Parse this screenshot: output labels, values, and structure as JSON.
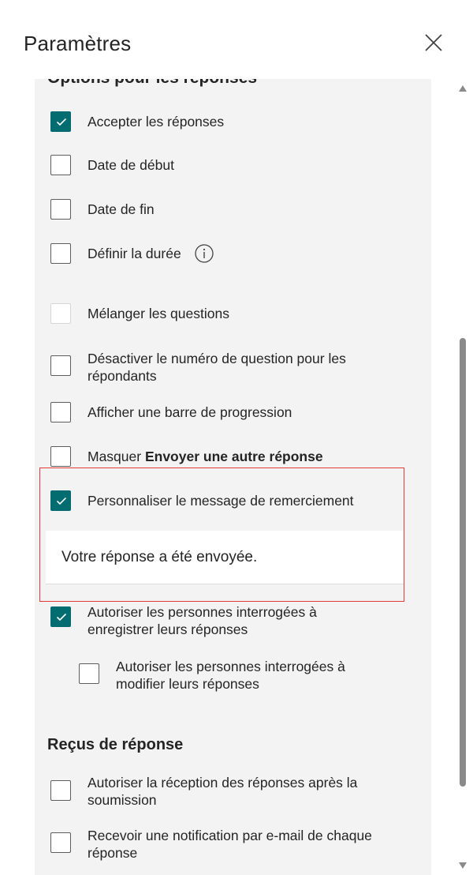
{
  "panel": {
    "title": "Paramètres"
  },
  "response_options": {
    "section_title": "Options pour les réponses",
    "items": [
      {
        "label": "Accepter les réponses",
        "checked": true
      },
      {
        "label": "Date de début",
        "checked": false
      },
      {
        "label": "Date de fin",
        "checked": false
      },
      {
        "label": "Définir la durée",
        "checked": false,
        "icon": "info-icon"
      },
      {
        "label": "Mélanger les questions",
        "checked": false,
        "disabled": true
      },
      {
        "label": "Désactiver le numéro de question pour les répondants",
        "checked": false
      },
      {
        "label": "Afficher une barre de progression",
        "checked": false
      },
      {
        "label_prefix": "Masquer ",
        "label_bold": "Envoyer une autre réponse",
        "checked": false
      },
      {
        "label": "Personnaliser le message de remerciement",
        "checked": true
      },
      {
        "label": "Autoriser les personnes interrogées à enregistrer leurs réponses",
        "checked": true
      },
      {
        "label": "Autoriser les personnes interrogées à modifier leurs réponses",
        "checked": false
      }
    ],
    "thank_you_message": "Votre réponse a été envoyée."
  },
  "receipts": {
    "section_title": "Reçus de réponse",
    "items": [
      {
        "label": "Autoriser la réception des réponses après la soumission",
        "checked": false
      },
      {
        "label": "Recevoir une notification par e-mail de chaque réponse",
        "checked": false
      }
    ]
  },
  "colors": {
    "accent": "#036c70",
    "highlight": "#e53935",
    "panel_bg": "#f3f3f3"
  }
}
